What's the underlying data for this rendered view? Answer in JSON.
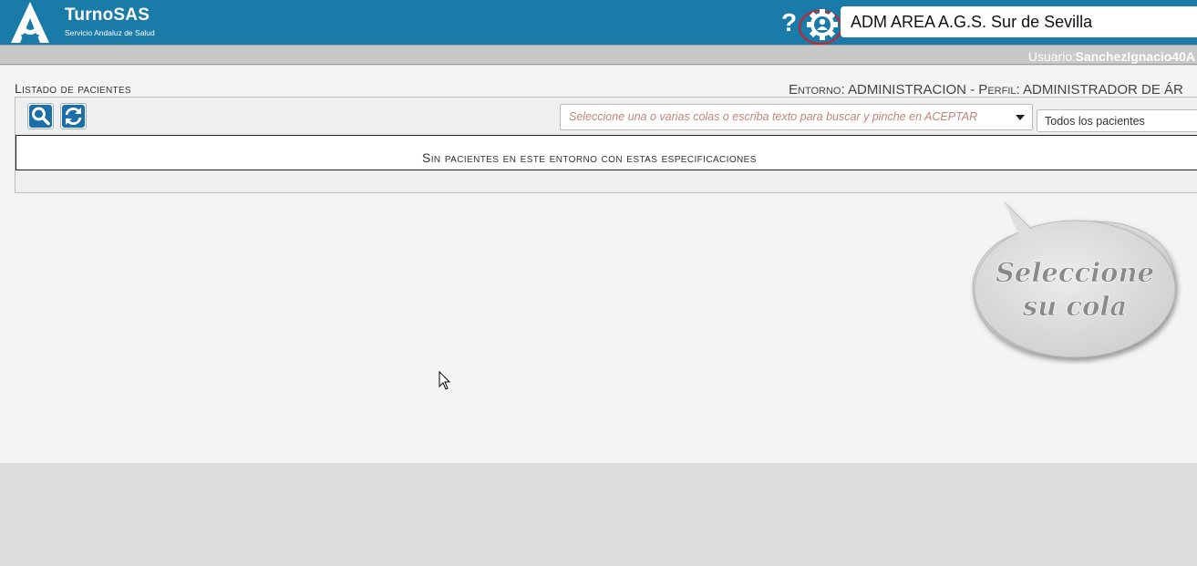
{
  "header": {
    "app_title": "TurnoSAS",
    "app_subtitle": "Servicio Andaluz de Salud",
    "help_glyph": "?",
    "area_name": "ADM AREA A.G.S. Sur de Sevilla"
  },
  "userbar": {
    "label": "Usuario:",
    "username": "SanchezIgnacio40A"
  },
  "main": {
    "list_title": "Listado de pacientes",
    "entorno_text": "Entorno: ADMINISTRACION - Perfil: ADMINISTRADOR DE ÁR",
    "queue_placeholder": "Seleccione una o varias colas o escriba texto para buscar y pinche en ACEPTAR",
    "patient_filter": "Todos los pacientes",
    "empty_message": "Sin pacientes en este entorno con estas especificaciones"
  },
  "tooltip": {
    "line1": "Seleccione",
    "line2": "su cola"
  },
  "icons": {
    "search": "search-icon",
    "refresh": "refresh-icon",
    "help": "help-icon",
    "settings": "user-settings-icon"
  },
  "colors": {
    "header_bg": "#1a7aa8",
    "icon_blue": "#1a6fa8",
    "highlight_ring": "#d0202a"
  }
}
